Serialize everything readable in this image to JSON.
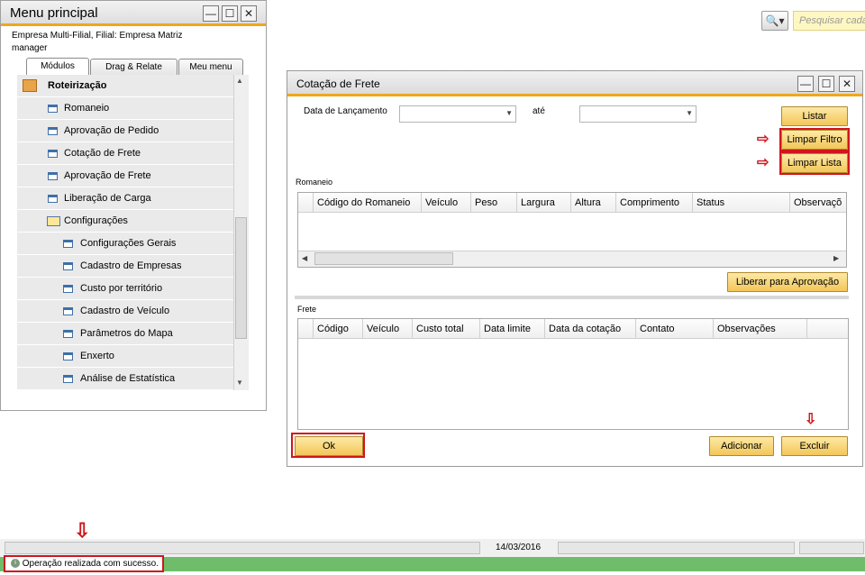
{
  "search": {
    "placeholder": "Pesquisar cada",
    "icon": "search-icon"
  },
  "menu": {
    "title": "Menu principal",
    "company_line1": "Empresa Multi-Filial, Filial: Empresa Matriz",
    "company_line2": "manager",
    "tabs": [
      "Módulos",
      "Drag & Relate",
      "Meu menu"
    ],
    "section": "Roteirização",
    "items": [
      "Romaneio",
      "Aprovação de Pedido",
      "Cotação de Frete",
      "Aprovação de Frete",
      "Liberação de Carga",
      "Configurações"
    ],
    "sub_items": [
      "Configurações Gerais",
      "Cadastro de Empresas",
      "Custo por território",
      "Cadastro de Veículo",
      "Parâmetros do Mapa",
      "Enxerto",
      "Análise de Estatística"
    ]
  },
  "cotacao": {
    "title": "Cotação de Frete",
    "date_label": "Data de Lançamento",
    "ate_label": "até",
    "buttons": {
      "listar": "Listar",
      "limpar_filtro": "Limpar Filtro",
      "limpar_lista": "Limpar Lista",
      "liberar": "Liberar para Aprovação",
      "ok": "Ok",
      "adicionar": "Adicionar",
      "excluir": "Excluir"
    },
    "romaneio_label": "Romaneio",
    "romaneio_columns": [
      "Código do Romaneio",
      "Veículo",
      "Peso",
      "Largura",
      "Altura",
      "Comprimento",
      "Status",
      "Observaçõ"
    ],
    "frete_label": "Frete",
    "frete_columns": [
      "Código",
      "Veículo",
      "Custo total",
      "Data limite",
      "Data da cotação",
      "Contato",
      "Observações"
    ]
  },
  "status": {
    "date": "14/03/2016",
    "message": "Operação realizada com sucesso.",
    "message_color": "#6fbd6a"
  },
  "colors": {
    "accent": "#f0a71a",
    "highlight": "#d0161c",
    "button": "#f3c658"
  }
}
